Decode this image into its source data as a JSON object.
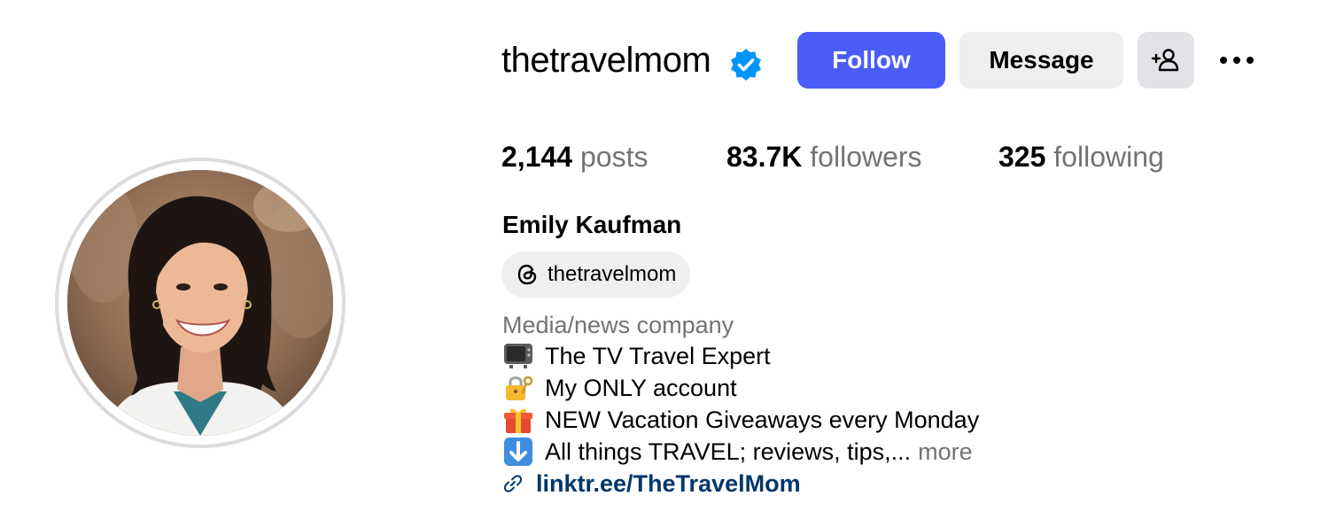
{
  "profile": {
    "username": "thetravelmom",
    "verified": true,
    "full_name": "Emily Kaufman",
    "threads_handle": "thetravelmom",
    "category": "Media/news company"
  },
  "actions": {
    "follow_label": "Follow",
    "message_label": "Message"
  },
  "stats": {
    "posts": {
      "value": "2,144",
      "label": "posts"
    },
    "followers": {
      "value": "83.7K",
      "label": "followers"
    },
    "following": {
      "value": "325",
      "label": "following"
    }
  },
  "bio": {
    "lines": [
      {
        "emoji": "television",
        "text": "The TV Travel Expert"
      },
      {
        "emoji": "locked-with-key",
        "text": "My ONLY account"
      },
      {
        "emoji": "wrapped-gift",
        "text": "NEW Vacation Giveaways every Monday"
      },
      {
        "emoji": "down-arrow",
        "text": "All things TRAVEL; reviews, tips,..."
      }
    ],
    "more_label": "more",
    "link_text": "linktr.ee/TheTravelMom"
  },
  "icons": {
    "verified": "verified-badge-icon",
    "add_user": "person-add-icon",
    "more": "more-options-icon",
    "threads": "threads-icon",
    "link": "link-icon"
  },
  "colors": {
    "follow_button": "#4a5df9",
    "verified_badge": "#0095f6",
    "link": "#00376b",
    "secondary_text": "#737373",
    "chip_background": "#efeff2"
  }
}
